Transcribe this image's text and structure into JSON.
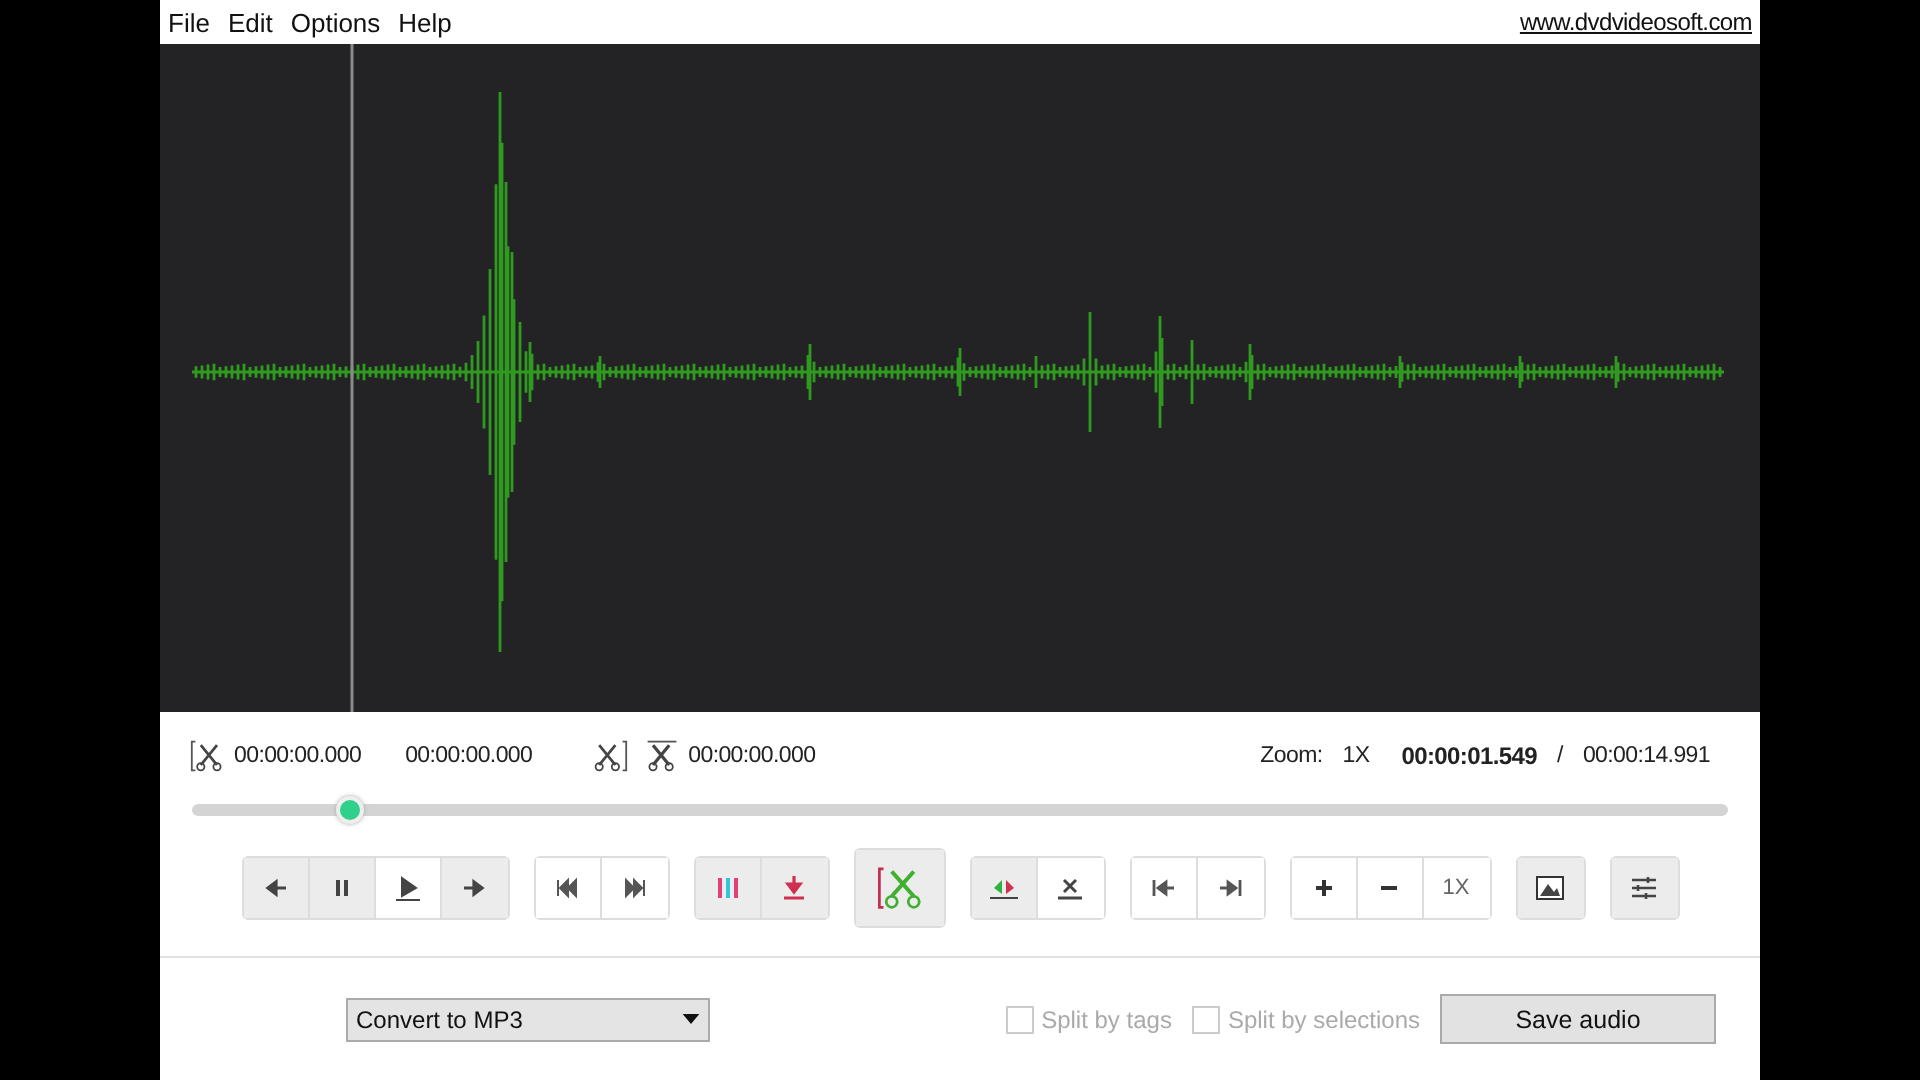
{
  "menu": [
    "File",
    "Edit",
    "Options",
    "Help"
  ],
  "website_link": "www.dvdvideosoft.com",
  "times": {
    "start": "00:00:00.000",
    "end": "00:00:00.000",
    "duration": "00:00:00.000",
    "zoom_label": "Zoom:",
    "zoom_value": "1X",
    "current": "00:00:01.549",
    "separator": "/",
    "total": "00:00:14.991"
  },
  "scrubber": {
    "level": 0.103
  },
  "toolbar": [
    [
      {
        "kind": "back",
        "highlighted": true
      },
      {
        "kind": "pause",
        "highlighted": true
      },
      {
        "kind": "play",
        "highlighted": false
      },
      {
        "kind": "forward",
        "highlighted": true
      }
    ],
    [
      {
        "kind": "skip-back",
        "highlighted": false
      },
      {
        "kind": "skip-forward",
        "highlighted": false
      }
    ],
    [
      {
        "kind": "split",
        "highlighted": true
      },
      {
        "kind": "download",
        "highlighted": true
      }
    ],
    [
      {
        "kind": "cut",
        "highlighted": true
      }
    ],
    [
      {
        "kind": "marker",
        "highlighted": true
      },
      {
        "kind": "clear",
        "highlighted": false
      }
    ],
    [
      {
        "kind": "go-start",
        "highlighted": false
      },
      {
        "kind": "go-end",
        "highlighted": false
      }
    ],
    [
      {
        "kind": "zoom-in",
        "highlighted": false
      },
      {
        "kind": "zoom-out",
        "highlighted": false
      },
      {
        "kind": "text",
        "label": "1X",
        "highlighted": false
      }
    ],
    [
      {
        "kind": "image",
        "highlighted": true
      }
    ],
    [
      {
        "kind": "settings",
        "highlighted": true
      }
    ]
  ],
  "format": {
    "value": "Convert to MP3"
  },
  "options": [
    {
      "label": "Split by tags",
      "checked": false,
      "disabled": true
    },
    {
      "label": "Split by selections",
      "checked": false,
      "disabled": true
    }
  ],
  "save_button": "Save audio"
}
